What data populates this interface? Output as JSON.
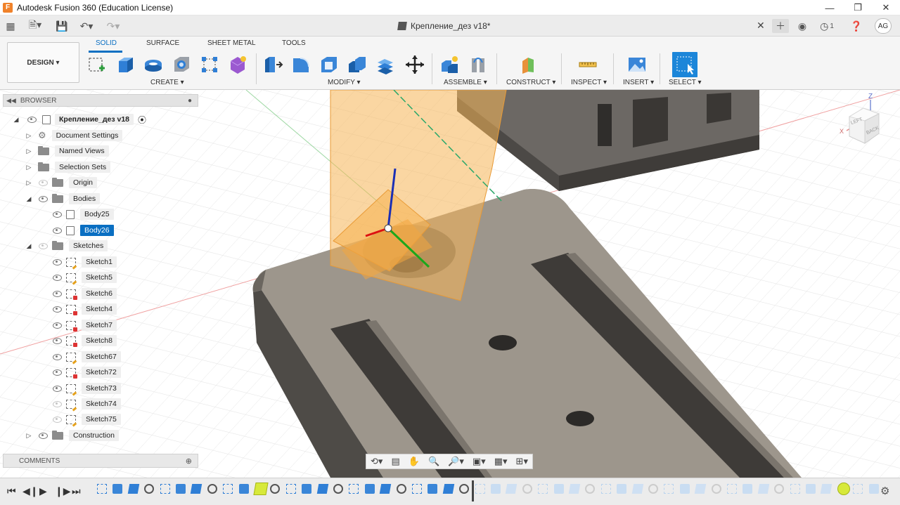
{
  "window": {
    "title": "Autodesk Fusion 360 (Education License)",
    "logo_letter": "F"
  },
  "quickbar": {
    "document_tab": "Крепление_дез v18*",
    "job_count": "1",
    "user_initials": "AG"
  },
  "ribbon": {
    "workspace": "DESIGN ▾",
    "tabs": [
      "SOLID",
      "SURFACE",
      "SHEET METAL",
      "TOOLS"
    ],
    "active_tab": "SOLID",
    "groups": [
      "CREATE ▾",
      "MODIFY ▾",
      "ASSEMBLE ▾",
      "CONSTRUCT ▾",
      "INSPECT ▾",
      "INSERT ▾",
      "SELECT ▾"
    ]
  },
  "browser": {
    "header": "BROWSER",
    "root": "Крепление_дез v18",
    "items": [
      {
        "label": "Document Settings",
        "icon": "gear-icon",
        "eye": "none"
      },
      {
        "label": "Named Views",
        "icon": "folder-icon",
        "eye": "none"
      },
      {
        "label": "Selection Sets",
        "icon": "folder-icon",
        "eye": "none"
      },
      {
        "label": "Origin",
        "icon": "folder-icon",
        "eye": "off"
      },
      {
        "label": "Bodies",
        "icon": "folder-icon",
        "eye": "on"
      },
      {
        "label": "Body25",
        "icon": "body-icon",
        "eye": "on"
      },
      {
        "label": "Body26",
        "icon": "body-icon",
        "eye": "on",
        "selected": true
      },
      {
        "label": "Sketches",
        "icon": "folder-icon",
        "eye": "off"
      },
      {
        "label": "Sketch1",
        "icon": "sketch-icon",
        "eye": "on"
      },
      {
        "label": "Sketch5",
        "icon": "sketch-icon",
        "eye": "on"
      },
      {
        "label": "Sketch6",
        "icon": "sketch-icon",
        "eye": "on"
      },
      {
        "label": "Sketch4",
        "icon": "sketch-icon",
        "eye": "on"
      },
      {
        "label": "Sketch7",
        "icon": "sketch-icon",
        "eye": "on"
      },
      {
        "label": "Sketch8",
        "icon": "sketch-icon",
        "eye": "on"
      },
      {
        "label": "Sketch67",
        "icon": "sketch-icon",
        "eye": "on"
      },
      {
        "label": "Sketch72",
        "icon": "sketch-icon",
        "eye": "on"
      },
      {
        "label": "Sketch73",
        "icon": "sketch-icon",
        "eye": "on"
      },
      {
        "label": "Sketch74",
        "icon": "sketch-icon",
        "eye": "off"
      },
      {
        "label": "Sketch75",
        "icon": "sketch-icon",
        "eye": "off"
      },
      {
        "label": "Construction",
        "icon": "folder-icon",
        "eye": "on"
      }
    ]
  },
  "comments": {
    "label": "COMMENTS"
  },
  "viewcube": {
    "top_label": "Z",
    "face_left": "LEFT",
    "face_back": "BACK",
    "axis_x": "X"
  },
  "colors": {
    "accent": "#0a6fc2",
    "plane": "#f6b455",
    "body_dark": "#5a5753",
    "body_light": "#9d968c"
  }
}
